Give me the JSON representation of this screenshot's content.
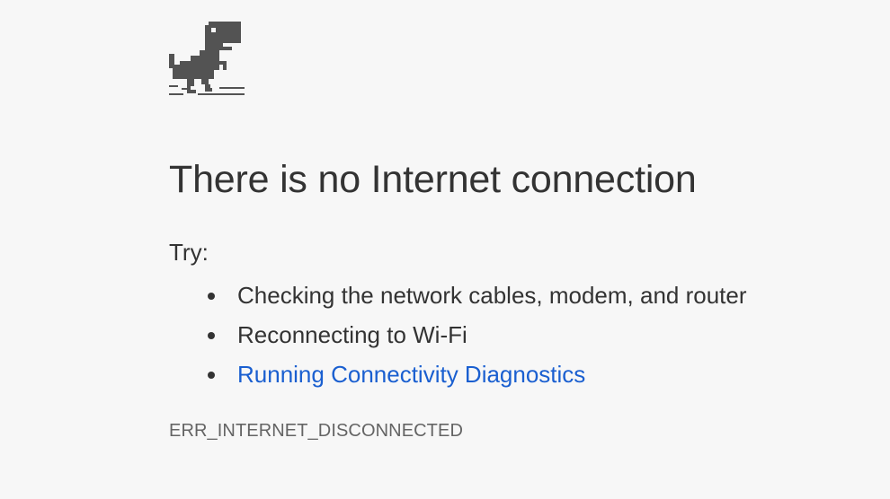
{
  "page": {
    "icon": "offline-dinosaur-icon",
    "heading": "There is no Internet connection",
    "try_label": "Try:",
    "suggestions": [
      {
        "text": "Checking the network cables, modem, and router",
        "is_link": false
      },
      {
        "text": "Reconnecting to Wi-Fi",
        "is_link": false
      },
      {
        "text": "Running Connectivity Diagnostics",
        "is_link": true
      }
    ],
    "error_code": "ERR_INTERNET_DISCONNECTED"
  },
  "colors": {
    "background": "#f7f7f7",
    "text": "#333333",
    "link": "#1a5fd0",
    "dino": "#535353",
    "error_code": "#646464"
  }
}
